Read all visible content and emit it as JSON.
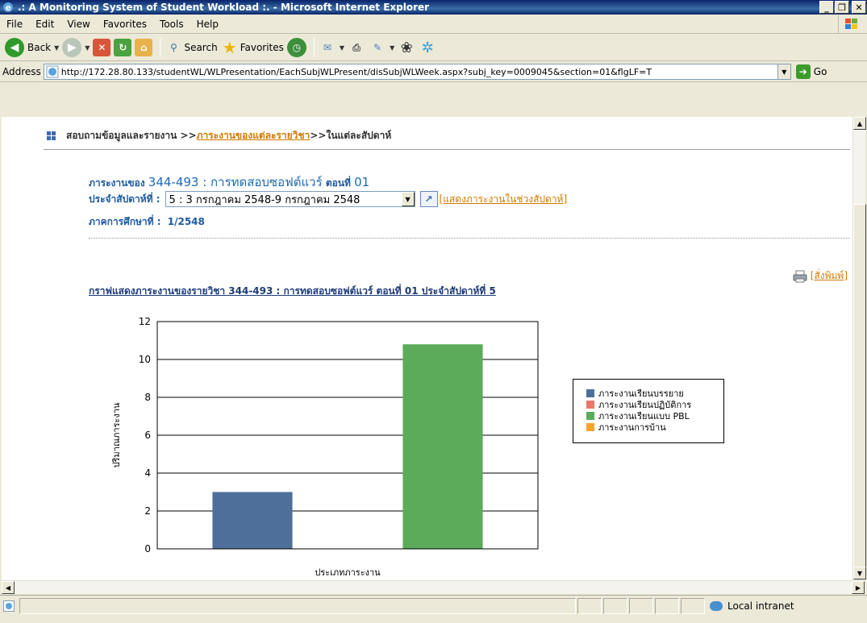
{
  "window": {
    "title": ".: A Monitoring System of Student Workload :. - Microsoft Internet Explorer",
    "min_label": "_",
    "max_label": "❐",
    "close_label": "✕"
  },
  "menu": {
    "items": [
      {
        "label": "File"
      },
      {
        "label": "Edit"
      },
      {
        "label": "View"
      },
      {
        "label": "Favorites"
      },
      {
        "label": "Tools"
      },
      {
        "label": "Help"
      }
    ]
  },
  "toolbar": {
    "back_label": "Back",
    "search_label": "Search",
    "favorites_label": "Favorites"
  },
  "address": {
    "label": "Address",
    "url": "http://172.28.80.133/studentWL/WLPresentation/EachSubjWLPresent/disSubjWLWeek.aspx?subj_key=0009045&section=01&flgLF=T",
    "go_label": "Go"
  },
  "page": {
    "breadcrumb": {
      "part1": "สอบถามข้อมูลและรายงาน >> ",
      "link": "ภาระงานของแต่ละรายวิชา",
      "part2": ">>ในแต่ละสัปดาห์"
    },
    "workload_of_label": "ภาระงานของ",
    "subject": "344-493 : การทดสอบซอฟต์แวร์",
    "section_label": "ตอนที่",
    "section": "01",
    "week_label": "ประจำสัปดาห์ที่ :",
    "week_selected": "5 : 3 กรกฎาคม 2548-9 กรกฎาคม 2548",
    "show_link": "[แสดงภาระงานในช่วงสัปดาห์]",
    "semester_label": "ภาคการศึกษาที่ :",
    "semester": "1/2548",
    "print_link": "[สั่งพิมพ์]",
    "chart_title": "กราฟแสดงภาระงานของรายวิชา 344-493 : การทดสอบซอฟต์แวร์ ตอนที่ 01 ประจำสัปดาห์ที่ 5"
  },
  "chart_data": {
    "type": "bar",
    "categories": [
      "ภาระงานเรียนบรรยาย",
      "ภาระงานเรียนแบบ PBL"
    ],
    "values": [
      3,
      10.8
    ],
    "bar_colors": [
      "#4f6f9b",
      "#5bab5b"
    ],
    "xlabel": "ประเภทภาระงาน",
    "ylabel": "ปริมาณภาระงาน",
    "ylim": [
      0,
      12
    ],
    "yticks": [
      0,
      2,
      4,
      6,
      8,
      10,
      12
    ],
    "grid": true,
    "legend_position": "right",
    "legend": [
      {
        "name": "ภาระงานเรียนบรรยาย",
        "color": "#4f6f9b"
      },
      {
        "name": "ภาระงานเรียนปฏิบัติการ",
        "color": "#e8786a"
      },
      {
        "name": "ภาระงานเรียนแบบ PBL",
        "color": "#5bab5b"
      },
      {
        "name": "ภาระงานการบ้าน",
        "color": "#f5a32e"
      }
    ]
  },
  "status": {
    "zone": "Local intranet"
  }
}
